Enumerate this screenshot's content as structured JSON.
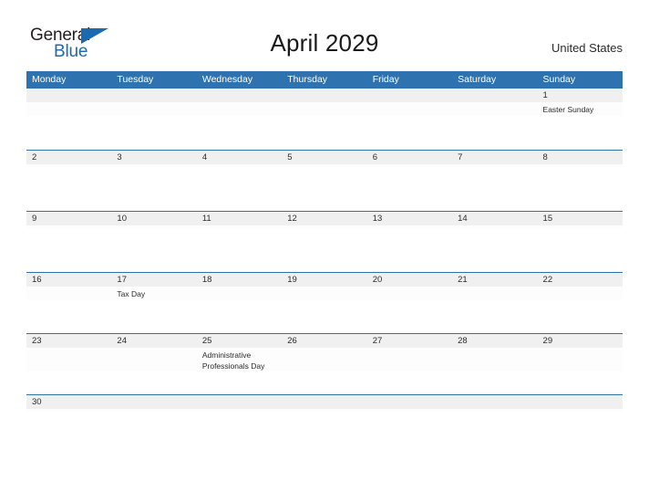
{
  "logo": {
    "text_top": "General",
    "text_bottom": "Blue",
    "color_dark": "#231f20",
    "color_blue": "#1b6ab0",
    "icon": "triangle-icon"
  },
  "header": {
    "title": "April 2029",
    "country": "United States"
  },
  "theme": {
    "header_blue": "#2e72b0",
    "date_band_gray": "#f0f0f0",
    "text_dark": "#2b2b2b",
    "cell_white": "#fdfdfd"
  },
  "calendar": {
    "weekdays": [
      "Monday",
      "Tuesday",
      "Wednesday",
      "Thursday",
      "Friday",
      "Saturday",
      "Sunday"
    ],
    "weeks": [
      {
        "days": [
          {
            "num": "",
            "event": ""
          },
          {
            "num": "",
            "event": ""
          },
          {
            "num": "",
            "event": ""
          },
          {
            "num": "",
            "event": ""
          },
          {
            "num": "",
            "event": ""
          },
          {
            "num": "",
            "event": ""
          },
          {
            "num": "1",
            "event": "Easter Sunday"
          }
        ]
      },
      {
        "days": [
          {
            "num": "2",
            "event": ""
          },
          {
            "num": "3",
            "event": ""
          },
          {
            "num": "4",
            "event": ""
          },
          {
            "num": "5",
            "event": ""
          },
          {
            "num": "6",
            "event": ""
          },
          {
            "num": "7",
            "event": ""
          },
          {
            "num": "8",
            "event": ""
          }
        ]
      },
      {
        "days": [
          {
            "num": "9",
            "event": ""
          },
          {
            "num": "10",
            "event": ""
          },
          {
            "num": "11",
            "event": ""
          },
          {
            "num": "12",
            "event": ""
          },
          {
            "num": "13",
            "event": ""
          },
          {
            "num": "14",
            "event": ""
          },
          {
            "num": "15",
            "event": ""
          }
        ]
      },
      {
        "days": [
          {
            "num": "16",
            "event": ""
          },
          {
            "num": "17",
            "event": "Tax Day"
          },
          {
            "num": "18",
            "event": ""
          },
          {
            "num": "19",
            "event": ""
          },
          {
            "num": "20",
            "event": ""
          },
          {
            "num": "21",
            "event": ""
          },
          {
            "num": "22",
            "event": ""
          }
        ]
      },
      {
        "days": [
          {
            "num": "23",
            "event": ""
          },
          {
            "num": "24",
            "event": ""
          },
          {
            "num": "25",
            "event": "Administrative Professionals Day"
          },
          {
            "num": "26",
            "event": ""
          },
          {
            "num": "27",
            "event": ""
          },
          {
            "num": "28",
            "event": ""
          },
          {
            "num": "29",
            "event": ""
          }
        ]
      },
      {
        "days": [
          {
            "num": "30",
            "event": ""
          },
          {
            "num": "",
            "event": ""
          },
          {
            "num": "",
            "event": ""
          },
          {
            "num": "",
            "event": ""
          },
          {
            "num": "",
            "event": ""
          },
          {
            "num": "",
            "event": ""
          },
          {
            "num": "",
            "event": ""
          }
        ]
      }
    ]
  }
}
